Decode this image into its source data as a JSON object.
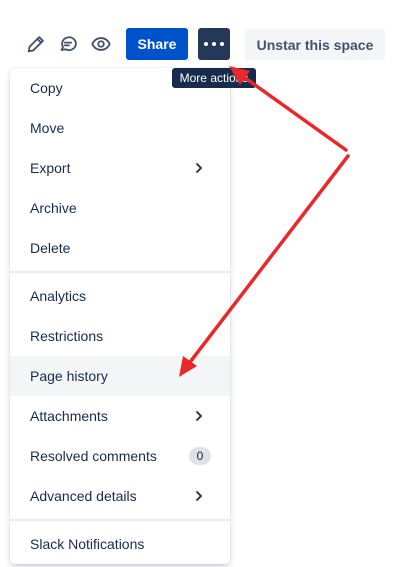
{
  "toolbar": {
    "edit_icon": "pencil-icon",
    "comment_icon": "comment-icon",
    "watch_icon": "eye-icon",
    "share_label": "Share",
    "more_icon": "ellipsis-icon",
    "unstar_label": "Unstar this space",
    "tooltip": "More actions"
  },
  "menu": {
    "groups": [
      {
        "items": [
          {
            "label": "Copy"
          },
          {
            "label": "Move"
          },
          {
            "label": "Export",
            "has_submenu": true
          },
          {
            "label": "Archive"
          },
          {
            "label": "Delete"
          }
        ]
      },
      {
        "items": [
          {
            "label": "Analytics"
          },
          {
            "label": "Restrictions"
          },
          {
            "label": "Page history",
            "highlighted": true
          },
          {
            "label": "Attachments",
            "has_submenu": true
          },
          {
            "label": "Resolved comments",
            "count": "0"
          },
          {
            "label": "Advanced details",
            "has_submenu": true
          }
        ]
      },
      {
        "items": [
          {
            "label": "Slack Notifications"
          }
        ]
      }
    ]
  },
  "colors": {
    "share_bg": "#0052cc",
    "more_bg": "#253858",
    "unstar_bg": "#f4f5f7",
    "tooltip_bg": "#172b4d",
    "highlight_bg": "#f4f5f7",
    "annotation_arrow": "#e8282b"
  }
}
